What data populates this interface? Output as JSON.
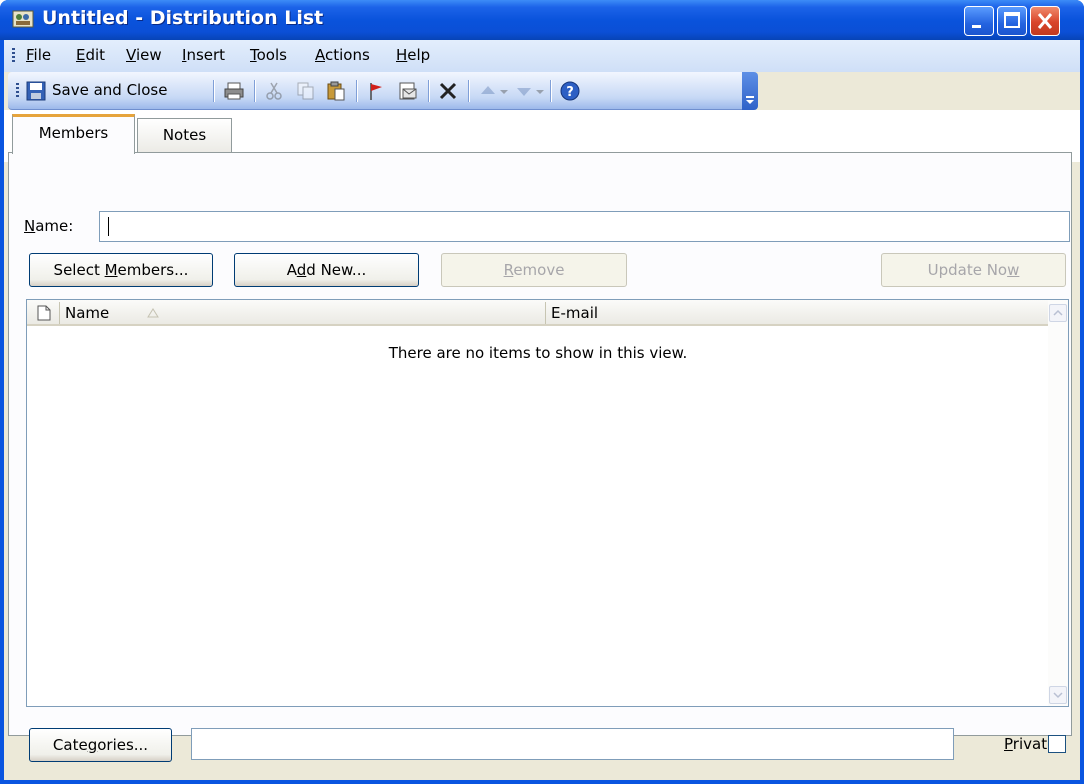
{
  "window": {
    "title": "Untitled - Distribution List"
  },
  "menu": {
    "items": [
      "File",
      "Edit",
      "View",
      "Insert",
      "Tools",
      "Actions",
      "Help"
    ]
  },
  "toolbar": {
    "save_close_label": "Save and Close"
  },
  "tabs": [
    {
      "label": "Members",
      "active": true
    },
    {
      "label": "Notes",
      "active": false
    }
  ],
  "form": {
    "name_label": "Name:",
    "name_value": "",
    "buttons": {
      "select_members": "Select Members...",
      "add_new": "Add New...",
      "remove": "Remove",
      "update_now": "Update Now"
    }
  },
  "list": {
    "columns": [
      "Name",
      "E-mail"
    ],
    "empty_message": "There are no items to show in this view."
  },
  "footer": {
    "categories_label": "Categories...",
    "categories_value": "",
    "private_label": "Private",
    "private_checked": false
  },
  "colors": {
    "titlebar": "#0a53dc",
    "toolbar": "#c6d8f5",
    "tab_accent": "#e6a43c",
    "dialog_bg": "#ece9d8"
  }
}
